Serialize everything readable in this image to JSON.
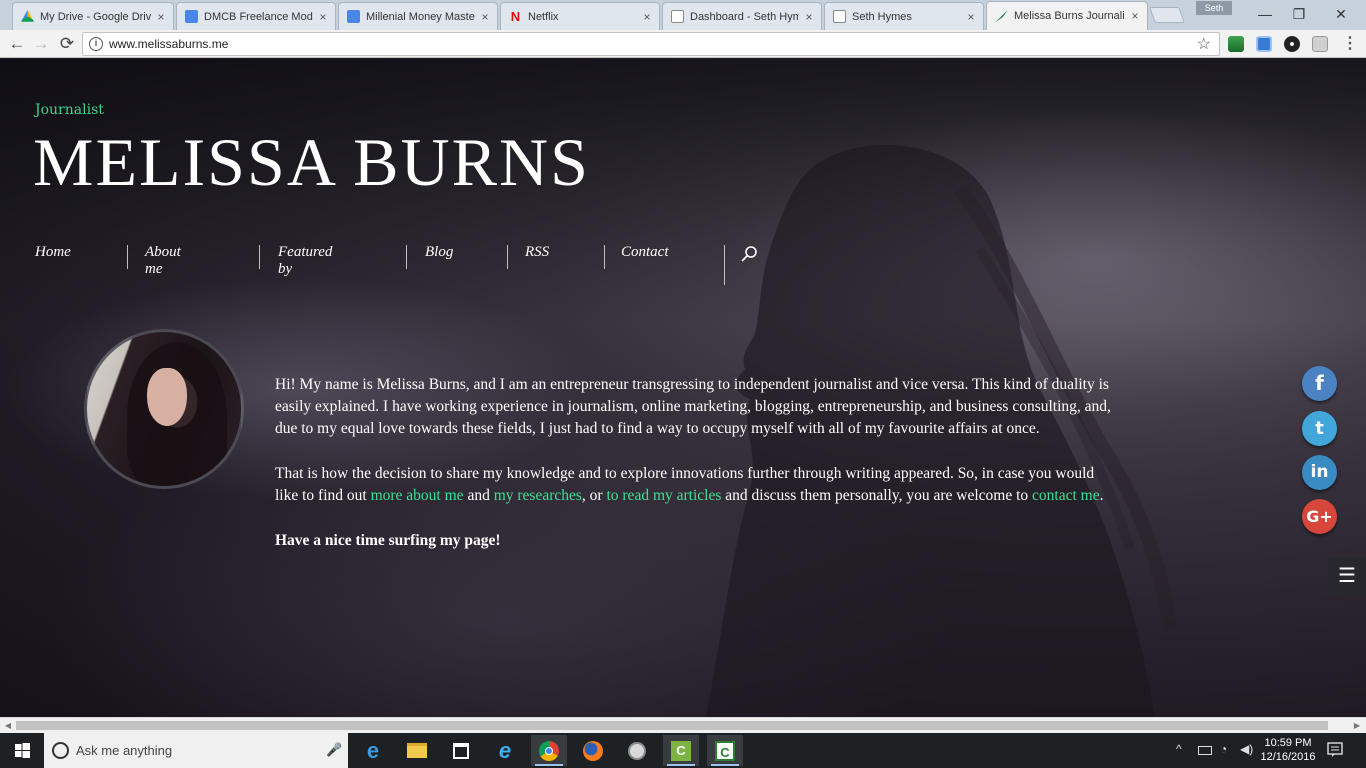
{
  "browser": {
    "tabs": [
      {
        "title": "My Drive - Google Driv",
        "favicon_color": "#f4b400",
        "active": false
      },
      {
        "title": "DMCB Freelance Modu",
        "favicon_color": "#4a86e8",
        "active": false
      },
      {
        "title": "Millenial Money Maste",
        "favicon_color": "#4a86e8",
        "active": false
      },
      {
        "title": "Netflix",
        "favicon_color": "#e50914",
        "active": false
      },
      {
        "title": "Dashboard - Seth Hym",
        "favicon_color": "#9e9e9e",
        "active": false
      },
      {
        "title": "Seth Hymes",
        "favicon_color": "#9e9e9e",
        "active": false
      },
      {
        "title": "Melissa Burns Journali",
        "favicon_color": "#3fa66a",
        "active": true
      }
    ],
    "tab_close_glyph": "×",
    "profile_name": "Seth",
    "window_controls": {
      "minimize": "—",
      "maximize": "❐",
      "close": "✕"
    },
    "nav": {
      "back": "←",
      "forward": "→",
      "reload": "⟳"
    },
    "url": "www.melissaburns.me",
    "info_glyph": "i",
    "bookmark_glyph": "☆",
    "menu_glyph": "⋮"
  },
  "site": {
    "tagline": "Journalist",
    "name": "MELISSA BURNS",
    "nav": [
      "Home",
      "About me",
      "Featured by",
      "Blog",
      "RSS",
      "Contact"
    ],
    "bio": {
      "p1": "Hi! My name is Melissa Burns, and I am an entrepreneur transgressing to independent journalist and vice versa. This kind of duality is easily explained. I have working experience in journalism, online marketing, blogging, entrepreneurship, and business consulting, and, due to my equal love towards these fields, I just had to find a way to occupy myself with all of my favourite affairs at once.",
      "p2_a": "That is how the decision to share my knowledge  and to explore innovations further through writing appeared. So, in case you would like to find out ",
      "link_about": "more about me",
      "p2_b": " and ",
      "link_research": "my researches",
      "p2_c": ", or ",
      "link_articles": "to read my articles",
      "p2_d": " and discuss them personally, you are welcome to ",
      "link_contact": "contact me",
      "p2_e": ".",
      "closing": "Have a nice time surfing my page!"
    },
    "social": {
      "facebook": "f",
      "twitter": "t",
      "linkedin": "in",
      "googleplus": "G+"
    },
    "menu_glyph": "☰",
    "accent_color": "#3fe092"
  },
  "scrollbar": {
    "left_arrow": "◀",
    "right_arrow": "▶"
  },
  "taskbar": {
    "search_placeholder": "Ask me anything",
    "mic_glyph": "🎤",
    "apps": [
      "edge-icon",
      "file-explorer-icon",
      "store-icon",
      "internet-explorer-icon",
      "chrome-icon",
      "firefox-icon",
      "app-icon",
      "camtasia-icon",
      "camtasia-recorder-icon"
    ],
    "tray_chevron": "^",
    "time": "10:59 PM",
    "date": "12/16/2016"
  }
}
